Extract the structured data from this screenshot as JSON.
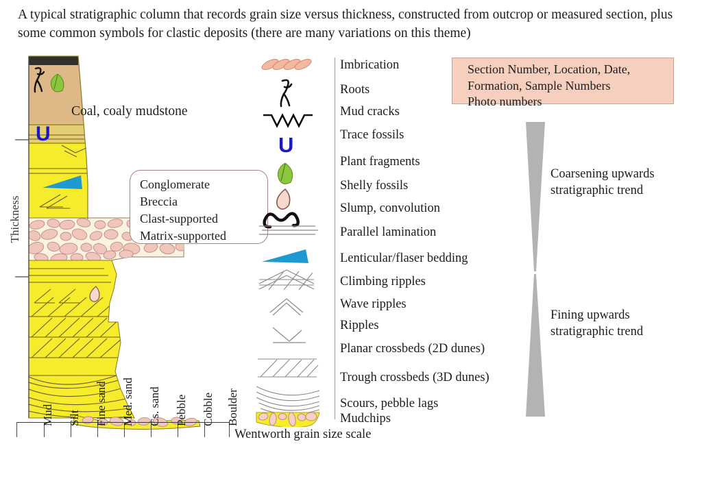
{
  "caption": "A typical stratigraphic column that records grain size versus thickness, constructed from outcrop or measured section, plus some common symbols for clastic deposits (there are many variations on this theme)",
  "column": {
    "axis_label_y": "Thickness",
    "coal_label": "Coal, coaly mudstone",
    "callout": {
      "lines": [
        "Conglomerate",
        "Breccia",
        "Clast-supported",
        "Matrix-supported"
      ],
      "border_color": "#b08080"
    },
    "colors": {
      "sandstone_yellow": "#f7ec2b",
      "mudstone_tan": "#deb887",
      "coal_black": "#332f2d",
      "clast_pink": "#f0c6bc",
      "conglomerate_matrix": "#fbf3e2",
      "lenticular_blue": "#1e9ad0",
      "trace_fossil_blue": "#1818c8",
      "plant_green": "#8cc63f"
    }
  },
  "grain_size_scale": {
    "title": "Wentworth grain size scale",
    "classes": [
      "Mud",
      "Silt",
      "Fine sand",
      "Med. sand",
      "Cs. sand",
      "Pebble",
      "Cobble",
      "Boulder"
    ],
    "tick_x": [
      0,
      40,
      79,
      118,
      157,
      196,
      235,
      274,
      310
    ]
  },
  "legend": {
    "items": [
      {
        "icon": "imbrication-icon",
        "label": "Imbrication"
      },
      {
        "icon": "roots-icon",
        "label": "Roots"
      },
      {
        "icon": "mud-cracks-icon",
        "label": "Mud cracks"
      },
      {
        "icon": "trace-fossils-icon",
        "label": "Trace fossils"
      },
      {
        "icon": "plant-fragments-icon",
        "label": "Plant fragments"
      },
      {
        "icon": "shelly-fossils-icon",
        "label": "Shelly fossils"
      },
      {
        "icon": "slump-convolution-icon",
        "label": "Slump, convolution"
      },
      {
        "icon": "parallel-lamination-icon",
        "label": "Parallel lamination"
      },
      {
        "icon": "lenticular-bedding-icon",
        "label": "Lenticular/flaser bedding"
      },
      {
        "icon": "climbing-ripples-icon",
        "label": "Climbing ripples"
      },
      {
        "icon": "wave-ripples-icon",
        "label": "Wave ripples"
      },
      {
        "icon": "ripples-icon",
        "label": "Ripples"
      },
      {
        "icon": "planar-crossbeds-icon",
        "label": "Planar crossbeds (2D dunes)"
      },
      {
        "icon": "trough-crossbeds-icon",
        "label": "Trough crossbeds (3D dunes)"
      },
      {
        "icon": "scours-pebble-lags-icon",
        "label": "Scours, pebble lags"
      },
      {
        "icon": "mudchips-icon",
        "label": "Mudchips"
      }
    ]
  },
  "info_box": {
    "lines": [
      "Section Number, Location, Date,",
      "Formation, Sample Numbers",
      "Photo numbers"
    ],
    "background": "#f7cfbe"
  },
  "trends": {
    "coarsening": {
      "line1": "Coarsening upwards",
      "line2": "stratigraphic trend"
    },
    "fining": {
      "line1": "Fining upwards",
      "line2": "stratigraphic trend"
    },
    "color": "#b3b3b3"
  }
}
